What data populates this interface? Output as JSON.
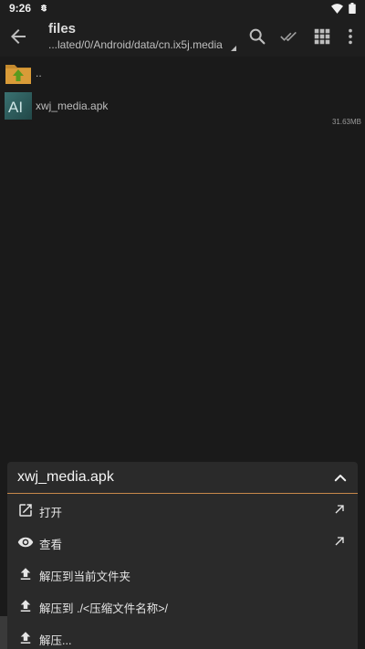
{
  "status_bar": {
    "time": "9:26",
    "icons": [
      "bug-icon",
      "wifi-icon",
      "battery-icon"
    ]
  },
  "app_bar": {
    "title": "files",
    "path": "...lated/0/Android/data/cn.ix5j.media",
    "icons": [
      "back-arrow-icon",
      "search-icon",
      "select-all-icon",
      "grid-view-icon",
      "more-vert-icon"
    ]
  },
  "files": [
    {
      "name": "..",
      "icon": "folder-up-icon",
      "size": ""
    },
    {
      "name": "xwj_media.apk",
      "icon": "apk-icon",
      "size": "31.63MB"
    }
  ],
  "sheet": {
    "title": "xwj_media.apk",
    "items": [
      {
        "label": "打开",
        "icon": "open-external-icon",
        "arrow": true
      },
      {
        "label": "查看",
        "icon": "eye-icon",
        "arrow": true
      },
      {
        "label": "解压到当前文件夹",
        "icon": "upload-icon",
        "arrow": false
      },
      {
        "label": "解压到 ./<压缩文件名称>/",
        "icon": "upload-icon",
        "arrow": false
      },
      {
        "label": "解压...",
        "icon": "upload-icon",
        "arrow": false
      }
    ]
  },
  "colors": {
    "background": "#1a1a1a",
    "bar": "#1e1e1e",
    "sheet": "#2a2a2a",
    "accent": "#c6884a"
  }
}
